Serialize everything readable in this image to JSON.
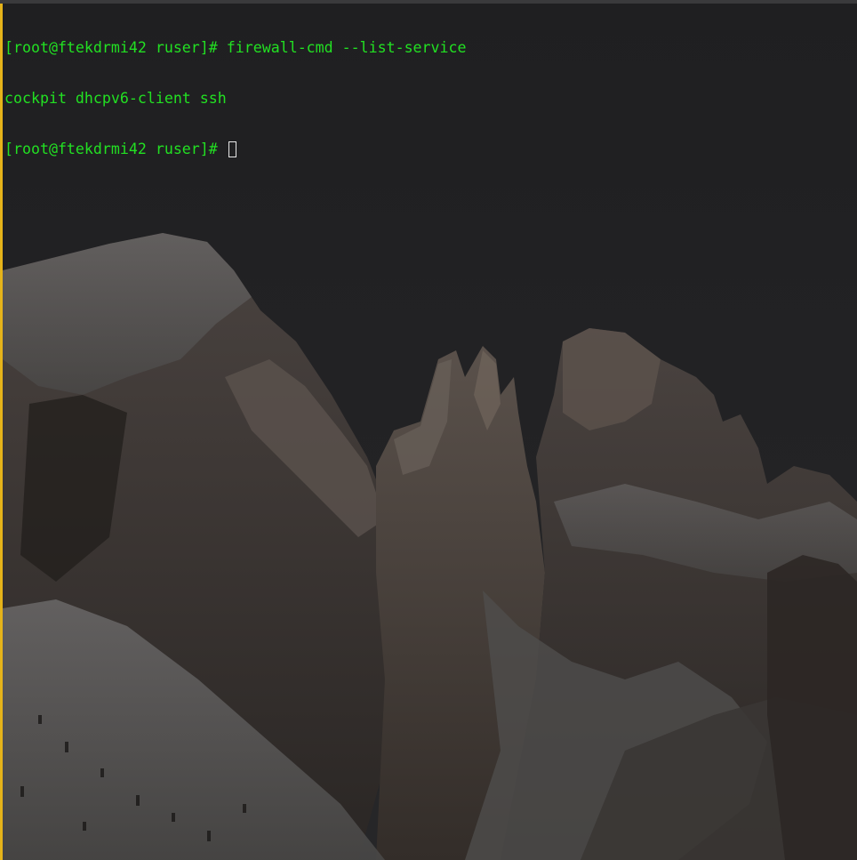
{
  "terminal": {
    "prompt": "[root@ftekdrmi42 ruser]# ",
    "command": "firewall-cmd --list-service",
    "output": "cockpit dhcpv6-client ssh",
    "current_prompt": "[root@ftekdrmi42 ruser]# "
  },
  "colors": {
    "text": "#22e022",
    "focus_border": "#e5b31a",
    "background": "#232325"
  },
  "wallpaper": {
    "subject": "snow-covered rocky mountain peaks at dusk"
  }
}
